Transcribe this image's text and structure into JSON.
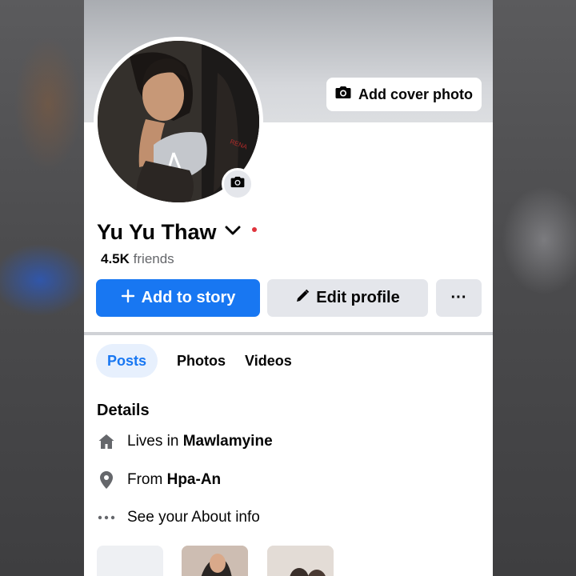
{
  "profile": {
    "name": "Yu Yu Thaw",
    "friends_count": "4.5K",
    "friends_label": "friends"
  },
  "cover": {
    "add_cover_label": "Add cover photo"
  },
  "actions": {
    "add_story_label": "Add to story",
    "edit_profile_label": "Edit profile",
    "more_label": "···"
  },
  "tabs": [
    {
      "label": "Posts",
      "active": true
    },
    {
      "label": "Photos",
      "active": false
    },
    {
      "label": "Videos",
      "active": false
    }
  ],
  "details": {
    "title": "Details",
    "lives_prefix": "Lives in",
    "lives_value": "Mawlamyine",
    "from_prefix": "From",
    "from_value": "Hpa-An",
    "about_label": "See your About info"
  },
  "colors": {
    "primary": "#1877f2",
    "secondary_button": "#e4e6eb",
    "text": "#050505",
    "muted": "#65676b",
    "tab_active_bg": "#e7f0fd"
  },
  "icons": [
    "camera-icon",
    "plus-icon",
    "pencil-icon",
    "more-icon",
    "chevron-down-icon",
    "home-icon",
    "location-pin-icon",
    "ellipsis-icon"
  ]
}
